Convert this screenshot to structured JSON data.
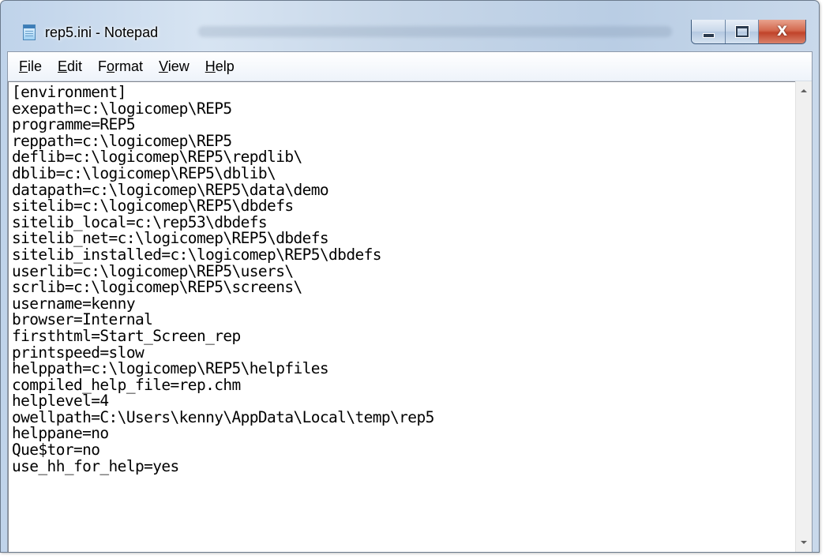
{
  "window": {
    "title": "rep5.ini - Notepad",
    "icon": "notepad-icon"
  },
  "caption_buttons": {
    "minimize": "minimize-icon",
    "maximize": "maximize-icon",
    "close": "close-icon",
    "close_glyph": "X"
  },
  "menu": {
    "file": "File",
    "edit": "Edit",
    "format": "Format",
    "view": "View",
    "help": "Help"
  },
  "editor": {
    "lines": [
      "[environment]",
      "exepath=c:\\logicomep\\REP5",
      "programme=REP5",
      "reppath=c:\\logicomep\\REP5",
      "deflib=c:\\logicomep\\REP5\\repdlib\\",
      "dblib=c:\\logicomep\\REP5\\dblib\\",
      "datapath=c:\\logicomep\\REP5\\data\\demo",
      "sitelib=c:\\logicomep\\REP5\\dbdefs",
      "sitelib_local=c:\\rep53\\dbdefs",
      "sitelib_net=c:\\logicomep\\REP5\\dbdefs",
      "sitelib_installed=c:\\logicomep\\REP5\\dbdefs",
      "userlib=c:\\logicomep\\REP5\\users\\",
      "scrlib=c:\\logicomep\\REP5\\screens\\",
      "username=kenny",
      "browser=Internal",
      "firsthtml=Start_Screen_rep",
      "printspeed=slow",
      "helppath=c:\\logicomep\\REP5\\helpfiles",
      "compiled_help_file=rep.chm",
      "helplevel=4",
      "owellpath=C:\\Users\\kenny\\AppData\\Local\\temp\\rep5",
      "helppane=no",
      "Que$tor=no",
      "use_hh_for_help=yes"
    ]
  },
  "scrollbar": {
    "up": "scroll-up-arrow-icon",
    "down": "scroll-down-arrow-icon"
  }
}
